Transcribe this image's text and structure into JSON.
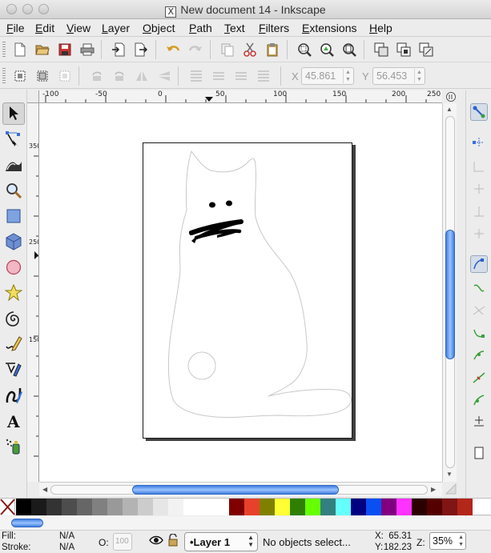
{
  "window": {
    "title": "New document 14 - Inkscape"
  },
  "menu": [
    "File",
    "Edit",
    "View",
    "Layer",
    "Object",
    "Path",
    "Text",
    "Filters",
    "Extensions",
    "Help"
  ],
  "toolbar_secondary": {
    "x_label": "X",
    "x_value": "45.861",
    "y_label": "Y",
    "y_value": "56.453"
  },
  "rulers": {
    "horizontal": [
      "-100",
      "-50",
      "0",
      "50",
      "100",
      "150",
      "200",
      "250"
    ],
    "vertical": [
      "350",
      "250",
      "150"
    ]
  },
  "palette": {
    "none_swatch": "no-paint",
    "colors": [
      "#000000",
      "#1a1a1a",
      "#333333",
      "#4d4d4d",
      "#666666",
      "#808080",
      "#999999",
      "#b3b3b3",
      "#cccccc",
      "#e6e6e6",
      "#f2f2f2",
      "#ffffff",
      "#ffffff",
      "#ffffff",
      "#800000",
      "#e8412b",
      "#808000",
      "#ffff33",
      "#2f8000",
      "#66ff00",
      "#338080",
      "#66ffff",
      "#000080",
      "#0a4ff2",
      "#800080",
      "#ff33ff",
      "#2b0000",
      "#550000",
      "#801515",
      "#b3261a"
    ]
  },
  "status": {
    "fill_label": "Fill:",
    "fill_value": "N/A",
    "stroke_label": "Stroke:",
    "stroke_value": "N/A",
    "opacity_label": "O:",
    "opacity_value": "100",
    "layer": "•Layer 1",
    "message": "No objects select...",
    "x_label": "X:",
    "x_value": "65.31",
    "y_label": "Y:",
    "y_value": "182.23",
    "zoom_label": "Z:",
    "zoom_value": "35%"
  }
}
